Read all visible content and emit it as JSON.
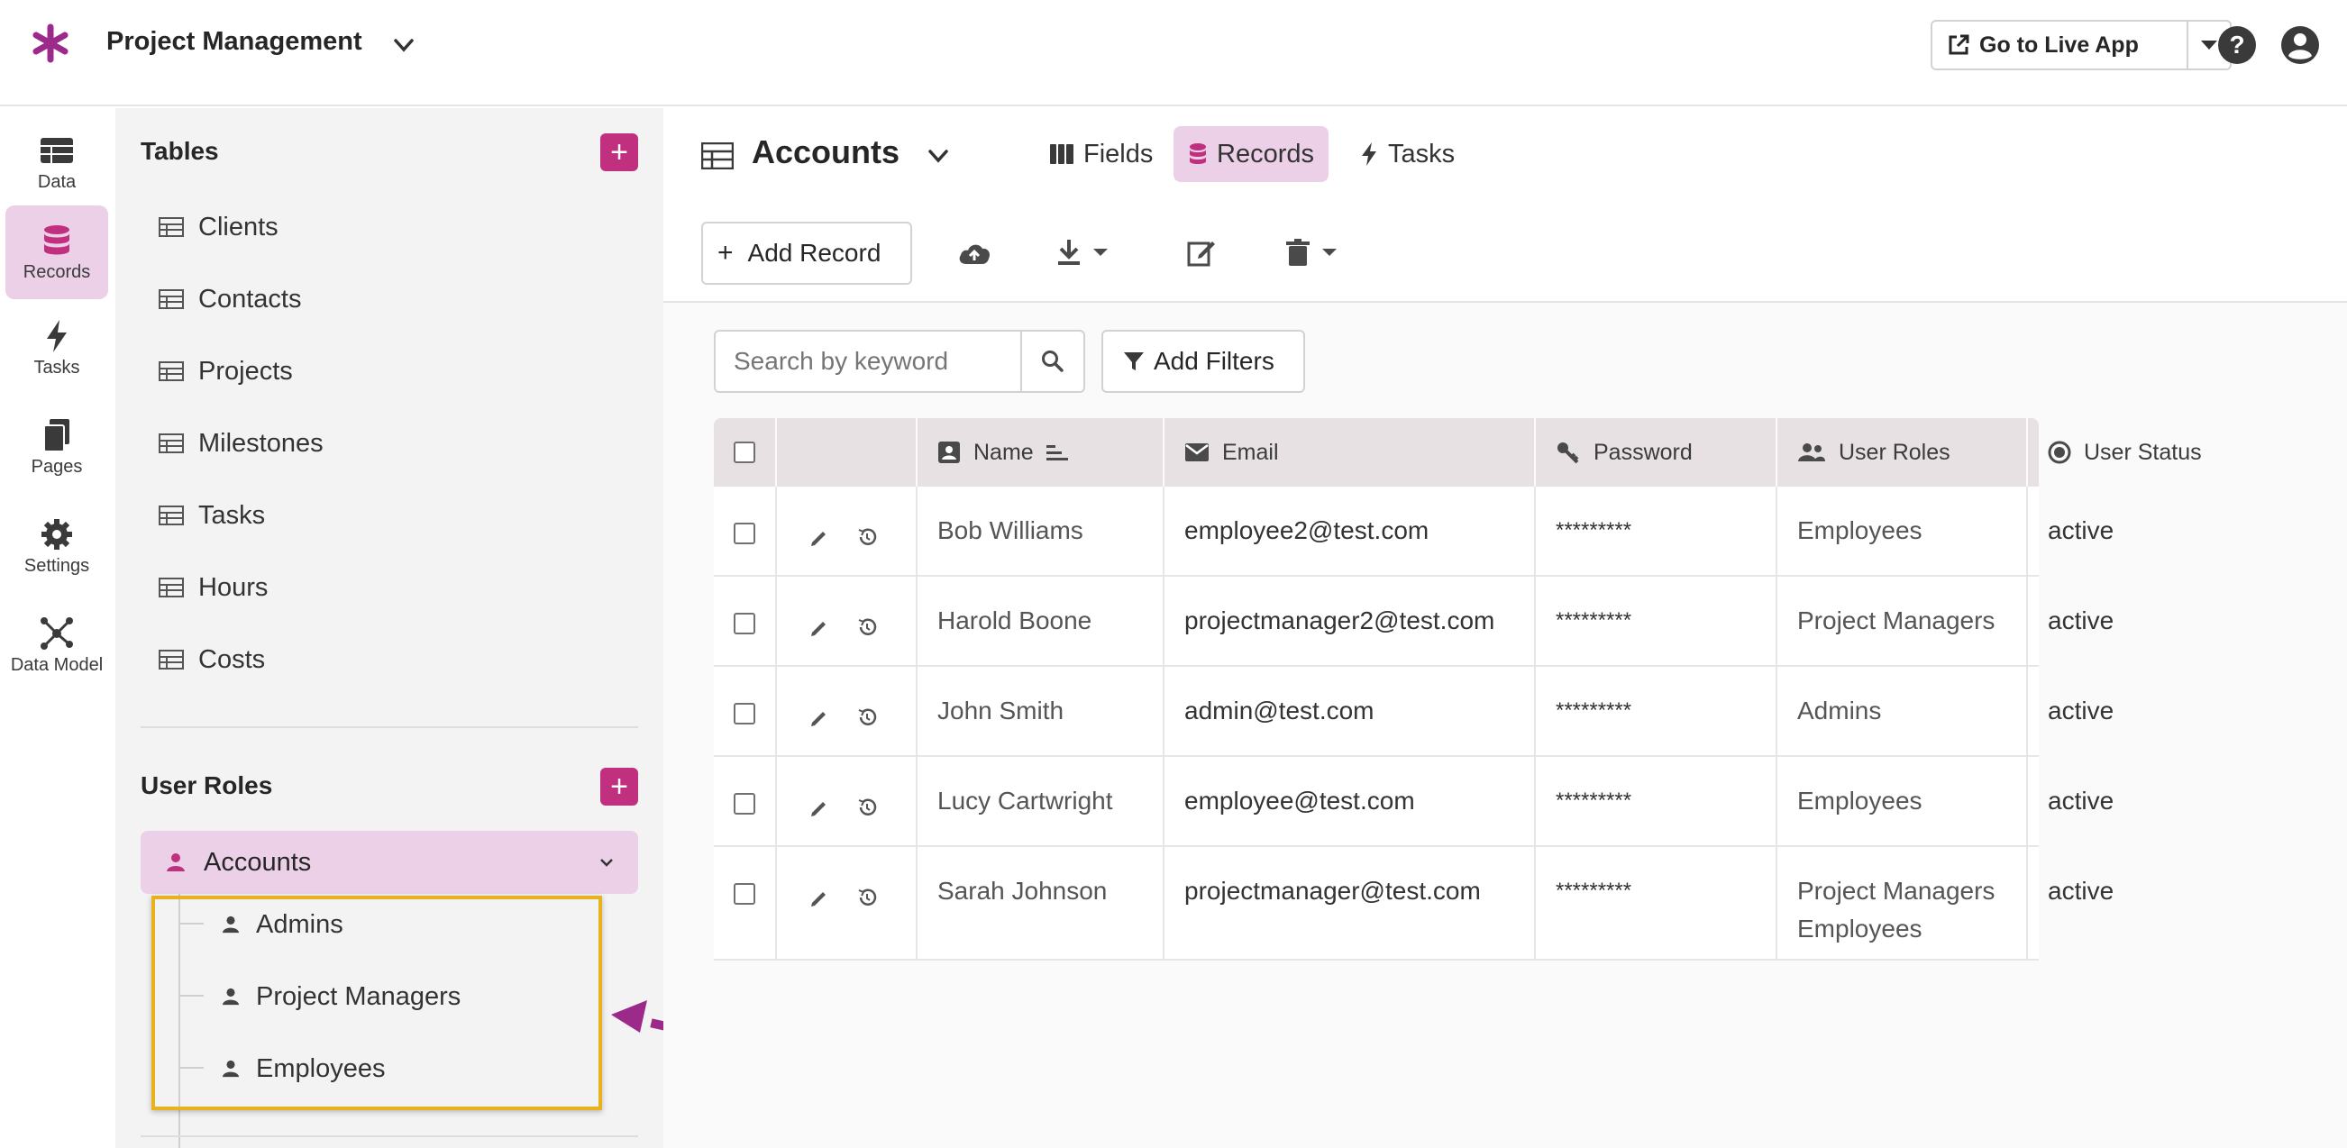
{
  "topbar": {
    "app_title": "Project Management",
    "live_button": "Go to Live App"
  },
  "rail": {
    "items": [
      {
        "label": "Data",
        "icon": "table-icon"
      },
      {
        "label": "Records",
        "icon": "database-icon"
      },
      {
        "label": "Tasks",
        "icon": "bolt-icon"
      },
      {
        "label": "Pages",
        "icon": "pages-icon"
      },
      {
        "label": "Settings",
        "icon": "gear-icon"
      },
      {
        "label": "Data Model",
        "icon": "graph-icon"
      }
    ]
  },
  "tables_panel": {
    "heading": "Tables",
    "plus": "+",
    "tables": [
      "Clients",
      "Contacts",
      "Projects",
      "Milestones",
      "Tasks",
      "Hours",
      "Costs"
    ],
    "roles_heading": "User Roles",
    "accounts": "Accounts",
    "roles": [
      "Admins",
      "Project Managers",
      "Employees"
    ]
  },
  "main": {
    "title": "Accounts",
    "tabs": [
      "Fields",
      "Records",
      "Tasks"
    ],
    "add_record": "Add Record",
    "search_placeholder": "Search by keyword",
    "add_filters": "Add Filters",
    "columns": [
      "Name",
      "Email",
      "Password",
      "User Roles",
      "User Status"
    ],
    "rows": [
      {
        "name": "Bob Williams",
        "email": "employee2@test.com",
        "password": "*********",
        "roles": [
          "Employees"
        ],
        "status": "active"
      },
      {
        "name": "Harold Boone",
        "email": "projectmanager2@test.com",
        "password": "*********",
        "roles": [
          "Project Managers"
        ],
        "status": "active"
      },
      {
        "name": "John Smith",
        "email": "admin@test.com",
        "password": "*********",
        "roles": [
          "Admins"
        ],
        "status": "active"
      },
      {
        "name": "Lucy Cartwright",
        "email": "employee@test.com",
        "password": "*********",
        "roles": [
          "Employees"
        ],
        "status": "active"
      },
      {
        "name": "Sarah Johnson",
        "email": "projectmanager@test.com",
        "password": "*********",
        "roles": [
          "Project Managers",
          "Employees"
        ],
        "status": "active"
      }
    ]
  },
  "colors": {
    "accent": "#c0307f",
    "accent_light": "#ecd0e8",
    "highlight": "#e8b21e",
    "arrow": "#9b2a8a"
  }
}
